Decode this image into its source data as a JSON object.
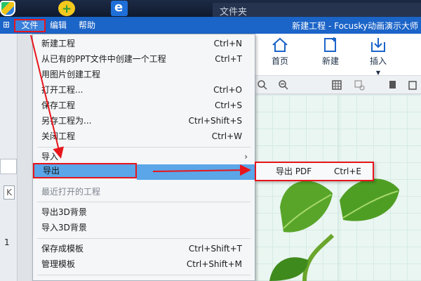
{
  "taskbar": {
    "folder_title": "文件夹"
  },
  "titlebar": {
    "title": "新建工程 - Focusky动画演示大师"
  },
  "menubar": {
    "file": "文件",
    "edit": "编辑",
    "help": "帮助"
  },
  "ribbon": {
    "home": "首页",
    "new": "新建",
    "insert": "插入"
  },
  "left_panel": {
    "slide_number": "1",
    "nav_glyph": "K"
  },
  "file_menu": {
    "items": [
      {
        "label": "新建工程",
        "shortcut": "Ctrl+N"
      },
      {
        "label": "从已有的PPT文件中创建一个工程",
        "shortcut": "Ctrl+T"
      },
      {
        "label": "用图片创建工程",
        "shortcut": ""
      },
      {
        "label": "打开工程...",
        "shortcut": "Ctrl+O"
      },
      {
        "label": "保存工程",
        "shortcut": "Ctrl+S"
      },
      {
        "label": "另存工程为...",
        "shortcut": "Ctrl+Shift+S"
      },
      {
        "label": "关闭工程",
        "shortcut": "Ctrl+W"
      },
      {
        "label": "导入",
        "shortcut": ""
      },
      {
        "label": "导出",
        "shortcut": ""
      },
      {
        "label": "最近打开的工程",
        "shortcut": ""
      },
      {
        "label": "导出3D背景",
        "shortcut": ""
      },
      {
        "label": "导入3D背景",
        "shortcut": ""
      },
      {
        "label": "保存成模板",
        "shortcut": "Ctrl+Shift+T"
      },
      {
        "label": "管理模板",
        "shortcut": "Ctrl+Shift+M"
      }
    ]
  },
  "submenu": {
    "label": "导出 PDF",
    "shortcut": "Ctrl+E"
  },
  "colors": {
    "highlight": "#5aa6e8",
    "annotation_red": "#e8151b",
    "titlebar": "#1b64c8"
  }
}
